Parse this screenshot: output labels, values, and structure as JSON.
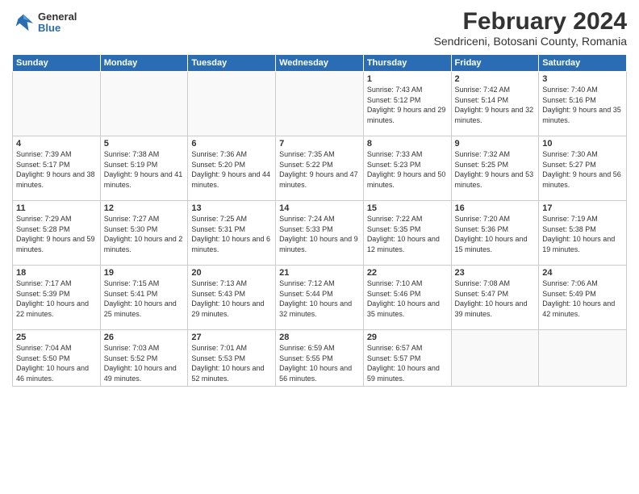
{
  "header": {
    "logo_general": "General",
    "logo_blue": "Blue",
    "main_title": "February 2024",
    "subtitle": "Sendriceni, Botosani County, Romania"
  },
  "days_of_week": [
    "Sunday",
    "Monday",
    "Tuesday",
    "Wednesday",
    "Thursday",
    "Friday",
    "Saturday"
  ],
  "weeks": [
    [
      {
        "day": "",
        "info": ""
      },
      {
        "day": "",
        "info": ""
      },
      {
        "day": "",
        "info": ""
      },
      {
        "day": "",
        "info": ""
      },
      {
        "day": "1",
        "info": "Sunrise: 7:43 AM\nSunset: 5:12 PM\nDaylight: 9 hours and 29 minutes."
      },
      {
        "day": "2",
        "info": "Sunrise: 7:42 AM\nSunset: 5:14 PM\nDaylight: 9 hours and 32 minutes."
      },
      {
        "day": "3",
        "info": "Sunrise: 7:40 AM\nSunset: 5:16 PM\nDaylight: 9 hours and 35 minutes."
      }
    ],
    [
      {
        "day": "4",
        "info": "Sunrise: 7:39 AM\nSunset: 5:17 PM\nDaylight: 9 hours and 38 minutes."
      },
      {
        "day": "5",
        "info": "Sunrise: 7:38 AM\nSunset: 5:19 PM\nDaylight: 9 hours and 41 minutes."
      },
      {
        "day": "6",
        "info": "Sunrise: 7:36 AM\nSunset: 5:20 PM\nDaylight: 9 hours and 44 minutes."
      },
      {
        "day": "7",
        "info": "Sunrise: 7:35 AM\nSunset: 5:22 PM\nDaylight: 9 hours and 47 minutes."
      },
      {
        "day": "8",
        "info": "Sunrise: 7:33 AM\nSunset: 5:23 PM\nDaylight: 9 hours and 50 minutes."
      },
      {
        "day": "9",
        "info": "Sunrise: 7:32 AM\nSunset: 5:25 PM\nDaylight: 9 hours and 53 minutes."
      },
      {
        "day": "10",
        "info": "Sunrise: 7:30 AM\nSunset: 5:27 PM\nDaylight: 9 hours and 56 minutes."
      }
    ],
    [
      {
        "day": "11",
        "info": "Sunrise: 7:29 AM\nSunset: 5:28 PM\nDaylight: 9 hours and 59 minutes."
      },
      {
        "day": "12",
        "info": "Sunrise: 7:27 AM\nSunset: 5:30 PM\nDaylight: 10 hours and 2 minutes."
      },
      {
        "day": "13",
        "info": "Sunrise: 7:25 AM\nSunset: 5:31 PM\nDaylight: 10 hours and 6 minutes."
      },
      {
        "day": "14",
        "info": "Sunrise: 7:24 AM\nSunset: 5:33 PM\nDaylight: 10 hours and 9 minutes."
      },
      {
        "day": "15",
        "info": "Sunrise: 7:22 AM\nSunset: 5:35 PM\nDaylight: 10 hours and 12 minutes."
      },
      {
        "day": "16",
        "info": "Sunrise: 7:20 AM\nSunset: 5:36 PM\nDaylight: 10 hours and 15 minutes."
      },
      {
        "day": "17",
        "info": "Sunrise: 7:19 AM\nSunset: 5:38 PM\nDaylight: 10 hours and 19 minutes."
      }
    ],
    [
      {
        "day": "18",
        "info": "Sunrise: 7:17 AM\nSunset: 5:39 PM\nDaylight: 10 hours and 22 minutes."
      },
      {
        "day": "19",
        "info": "Sunrise: 7:15 AM\nSunset: 5:41 PM\nDaylight: 10 hours and 25 minutes."
      },
      {
        "day": "20",
        "info": "Sunrise: 7:13 AM\nSunset: 5:43 PM\nDaylight: 10 hours and 29 minutes."
      },
      {
        "day": "21",
        "info": "Sunrise: 7:12 AM\nSunset: 5:44 PM\nDaylight: 10 hours and 32 minutes."
      },
      {
        "day": "22",
        "info": "Sunrise: 7:10 AM\nSunset: 5:46 PM\nDaylight: 10 hours and 35 minutes."
      },
      {
        "day": "23",
        "info": "Sunrise: 7:08 AM\nSunset: 5:47 PM\nDaylight: 10 hours and 39 minutes."
      },
      {
        "day": "24",
        "info": "Sunrise: 7:06 AM\nSunset: 5:49 PM\nDaylight: 10 hours and 42 minutes."
      }
    ],
    [
      {
        "day": "25",
        "info": "Sunrise: 7:04 AM\nSunset: 5:50 PM\nDaylight: 10 hours and 46 minutes."
      },
      {
        "day": "26",
        "info": "Sunrise: 7:03 AM\nSunset: 5:52 PM\nDaylight: 10 hours and 49 minutes."
      },
      {
        "day": "27",
        "info": "Sunrise: 7:01 AM\nSunset: 5:53 PM\nDaylight: 10 hours and 52 minutes."
      },
      {
        "day": "28",
        "info": "Sunrise: 6:59 AM\nSunset: 5:55 PM\nDaylight: 10 hours and 56 minutes."
      },
      {
        "day": "29",
        "info": "Sunrise: 6:57 AM\nSunset: 5:57 PM\nDaylight: 10 hours and 59 minutes."
      },
      {
        "day": "",
        "info": ""
      },
      {
        "day": "",
        "info": ""
      }
    ]
  ]
}
